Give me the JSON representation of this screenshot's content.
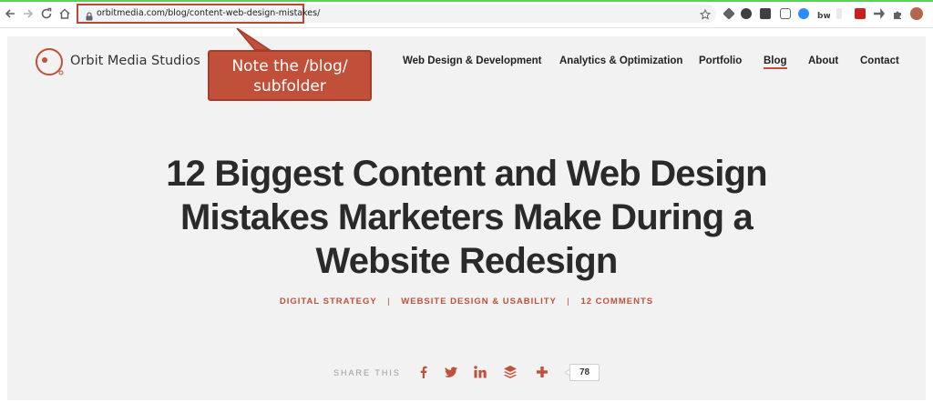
{
  "browser": {
    "url": "orbitmedia.com/blog/content-web-design-mistakes/"
  },
  "site": {
    "logo_text": "Orbit Media Studios",
    "brand_color": "#c0503a",
    "nav": [
      {
        "label": "Web Design & Development"
      },
      {
        "label": "Analytics & Optimization"
      },
      {
        "label": "Portfolio"
      },
      {
        "label": "Blog",
        "active": true
      },
      {
        "label": "About"
      },
      {
        "label": "Contact"
      }
    ]
  },
  "annotation": {
    "line1": "Note the /blog/",
    "line2": "subfolder"
  },
  "article": {
    "title_line1": "12 Biggest Content and Web Design",
    "title_line2": "Mistakes Marketers Make During a",
    "title_line3": "Website Redesign",
    "categories": [
      "DIGITAL STRATEGY",
      "WEBSITE DESIGN & USABILITY",
      "12 COMMENTS"
    ],
    "separator": "|"
  },
  "share": {
    "label": "SHARE THIS",
    "icons": [
      "facebook-icon",
      "twitter-icon",
      "linkedin-icon",
      "buffer-icon",
      "plus-icon"
    ],
    "count": "78"
  }
}
